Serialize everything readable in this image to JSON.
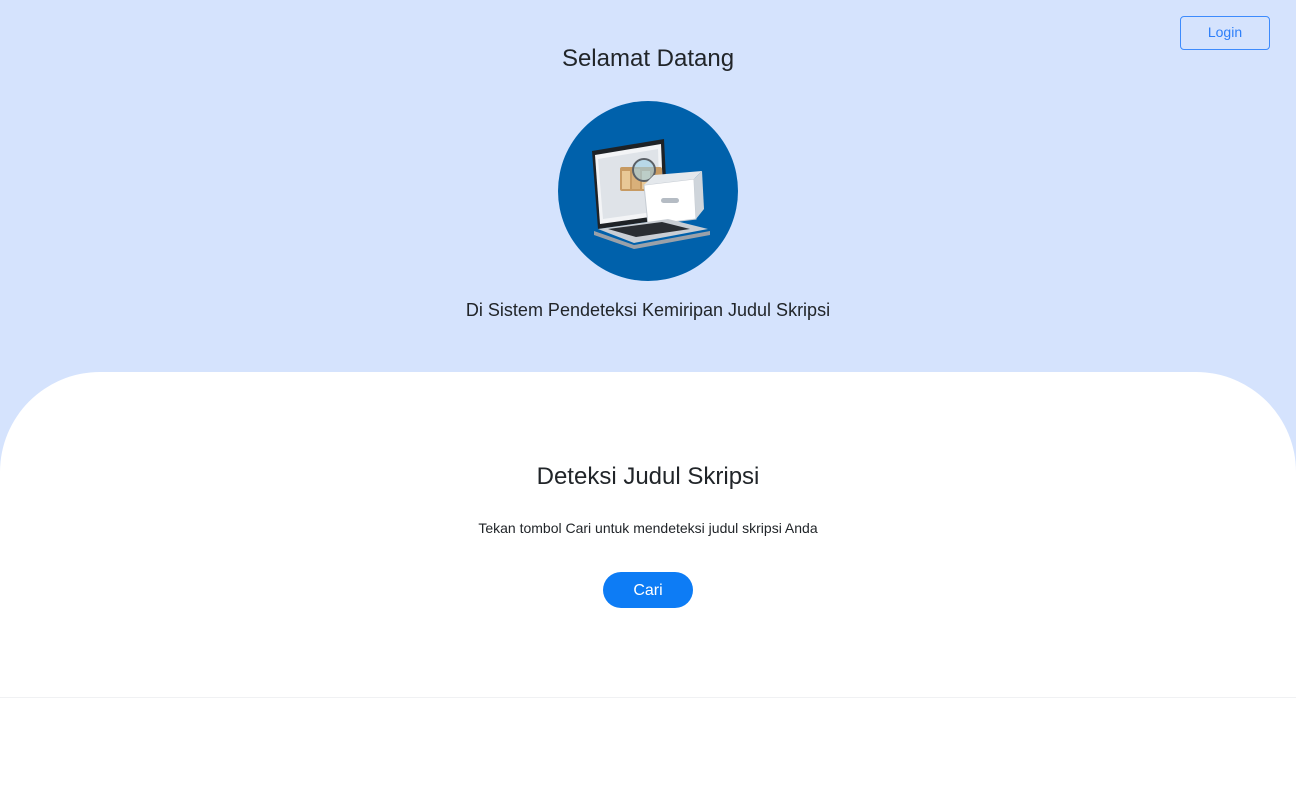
{
  "header": {
    "login_label": "Login"
  },
  "hero": {
    "title": "Selamat Datang",
    "subtitle": "Di Sistem Pendeteksi Kemiripan Judul Skripsi",
    "logo_icon": "laptop-file-drawer-icon"
  },
  "main": {
    "title": "Deteksi Judul Skripsi",
    "instruction": "Tekan tombol Cari untuk mendeteksi judul skripsi Anda",
    "search_label": "Cari"
  },
  "colors": {
    "hero_background": "#d5e3fd",
    "primary": "#0d7cf5",
    "logo_background": "#0061ab"
  }
}
